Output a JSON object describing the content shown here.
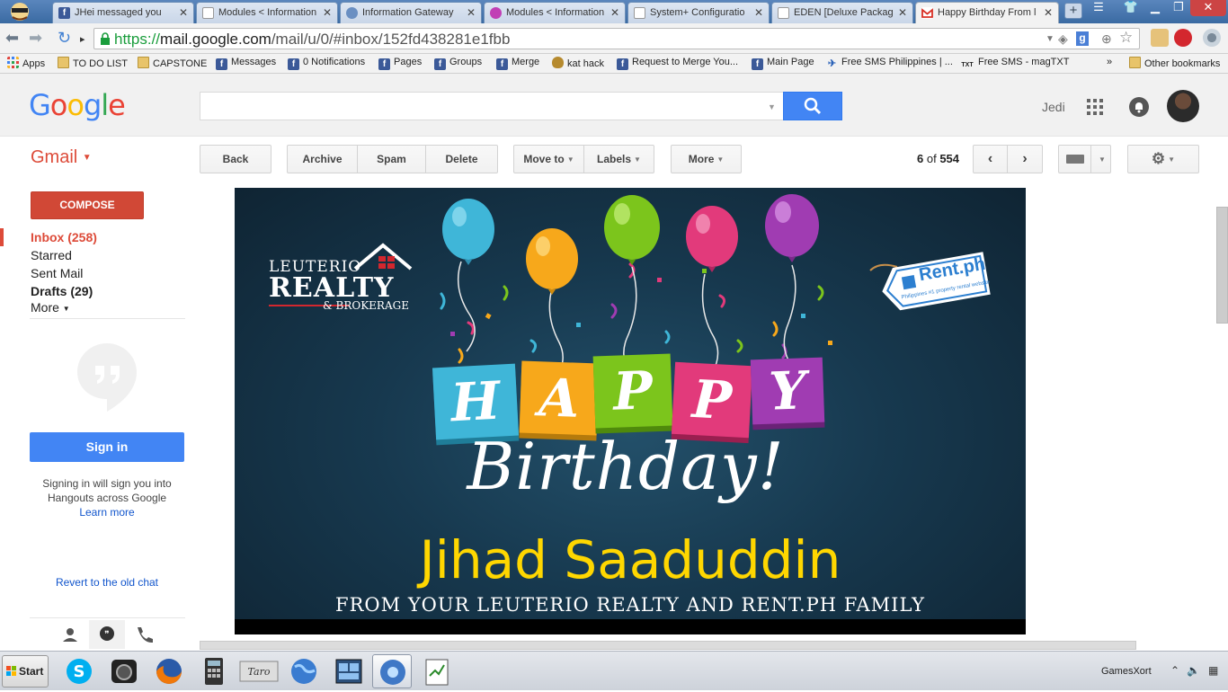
{
  "browser": {
    "tabs": [
      {
        "label": "JHei messaged you",
        "favicon": "facebook-icon",
        "active": false
      },
      {
        "label": "Modules < Information",
        "favicon": "page-icon",
        "active": false
      },
      {
        "label": "Information Gateway",
        "favicon": "globe-icon",
        "active": false
      },
      {
        "label": "Modules < Information",
        "favicon": "purple-icon",
        "active": false
      },
      {
        "label": "System+ Configuratio",
        "favicon": "page-icon",
        "active": false
      },
      {
        "label": "EDEN [Deluxe Packag",
        "favicon": "page-icon",
        "active": false
      },
      {
        "label": "Happy Birthday From l",
        "favicon": "gmail-icon",
        "active": true
      }
    ],
    "url": {
      "scheme": "https://",
      "host": "mail.google.com",
      "path": "/mail/u/0/#inbox/152fd438281e1fbb"
    }
  },
  "bookmarks": [
    {
      "label": "Apps",
      "icon": "apps-icon"
    },
    {
      "label": "TO DO LIST",
      "icon": "folder-icon"
    },
    {
      "label": "CAPSTONE",
      "icon": "folder-icon"
    },
    {
      "label": "Messages",
      "icon": "facebook-icon"
    },
    {
      "label": "0 Notifications",
      "icon": "facebook-icon"
    },
    {
      "label": "Pages",
      "icon": "facebook-icon"
    },
    {
      "label": "Groups",
      "icon": "facebook-icon"
    },
    {
      "label": "Merge",
      "icon": "facebook-icon"
    },
    {
      "label": "kat hack",
      "icon": "shield-icon"
    },
    {
      "label": "Request to Merge You...",
      "icon": "facebook-icon"
    },
    {
      "label": "Main Page",
      "icon": "facebook-icon"
    },
    {
      "label": "Free SMS Philippines | ...",
      "icon": "sms-icon"
    },
    {
      "label": "Free SMS - magTXT",
      "icon": "txt-icon"
    },
    {
      "label": "»",
      "icon": ""
    },
    {
      "label": "Other bookmarks",
      "icon": "folder-icon"
    }
  ],
  "gmail": {
    "logo": "Google",
    "search": {
      "value": "",
      "placeholder": ""
    },
    "user": "Jedi",
    "app_label": "Gmail",
    "actions": {
      "back": "Back",
      "archive": "Archive",
      "spam": "Spam",
      "delete": "Delete",
      "move_to": "Move to",
      "labels": "Labels",
      "more": "More"
    },
    "pager": {
      "current": "6",
      "sep": "of",
      "total": "554"
    },
    "compose": "COMPOSE",
    "nav": {
      "inbox": "Inbox (258)",
      "starred": "Starred",
      "sent": "Sent Mail",
      "drafts": "Drafts (29)",
      "more": "More"
    },
    "hangouts": {
      "signin": "Sign in",
      "text": "Signing in will sign you into Hangouts across Google",
      "learn_more": "Learn more",
      "revert": "Revert to the old chat"
    }
  },
  "email_banner": {
    "realty_top": "LEUTERIO",
    "realty_main": "REALTY",
    "realty_sub": "& BROKERAGE",
    "rent_brand": "Rent.ph",
    "rent_tagline": "Philippines #1 property rental website",
    "happy_letters": [
      "H",
      "A",
      "P",
      "P",
      "Y"
    ],
    "birthday": "Birthday!",
    "recipient": "Jihad Saaduddin",
    "from_line": "FROM YOUR LEUTERIO REALTY AND RENT.PH FAMILY",
    "colors": {
      "name_yellow": "#ffd700",
      "balloon_blue": "#3fb6d8",
      "balloon_orange": "#f7a81b",
      "balloon_green": "#7cc51c",
      "balloon_pink": "#e23a7b",
      "balloon_purple": "#a03cb2"
    }
  },
  "taskbar": {
    "start": "Start",
    "tray_label": "GamesXort",
    "apps": [
      "skype-icon",
      "camera-icon",
      "firefox-icon",
      "calculator-icon",
      "taro-app-icon",
      "globe-icon",
      "window-app-icon",
      "chrome-globe-icon",
      "notepad-icon"
    ]
  }
}
